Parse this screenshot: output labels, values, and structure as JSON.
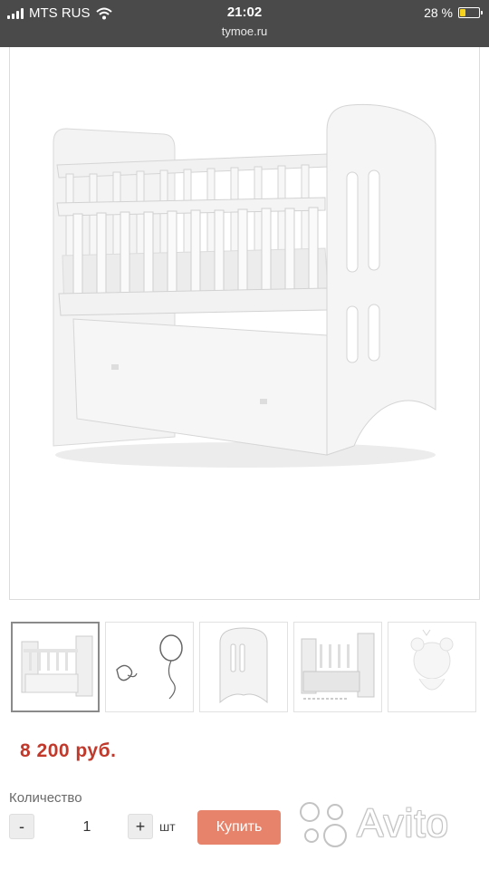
{
  "status_bar": {
    "carrier": "MTS RUS",
    "time": "21:02",
    "url": "tymoe.ru",
    "battery_percent": "28 %",
    "battery_level": 0.28,
    "battery_color": "#f7d21c",
    "icons": [
      "signal-icon",
      "wifi-icon",
      "battery-icon"
    ]
  },
  "product": {
    "main_image": "crib-photo",
    "thumbnails": [
      {
        "name": "crib-thumbnail",
        "active": true
      },
      {
        "name": "pacifier-balloon-thumbnail",
        "active": false
      },
      {
        "name": "crib-headboard-thumbnail",
        "active": false
      },
      {
        "name": "crib-drawer-thumbnail",
        "active": false
      },
      {
        "name": "bear-decal-thumbnail",
        "active": false
      }
    ],
    "price": "8 200 руб.",
    "price_color": "#c0392b"
  },
  "quantity": {
    "label": "Количество",
    "minus": "-",
    "value": "1",
    "plus": "+",
    "unit": "шт"
  },
  "buy_button": {
    "label": "Купить",
    "color": "#e8836b"
  },
  "watermark": {
    "text": "Avito"
  }
}
